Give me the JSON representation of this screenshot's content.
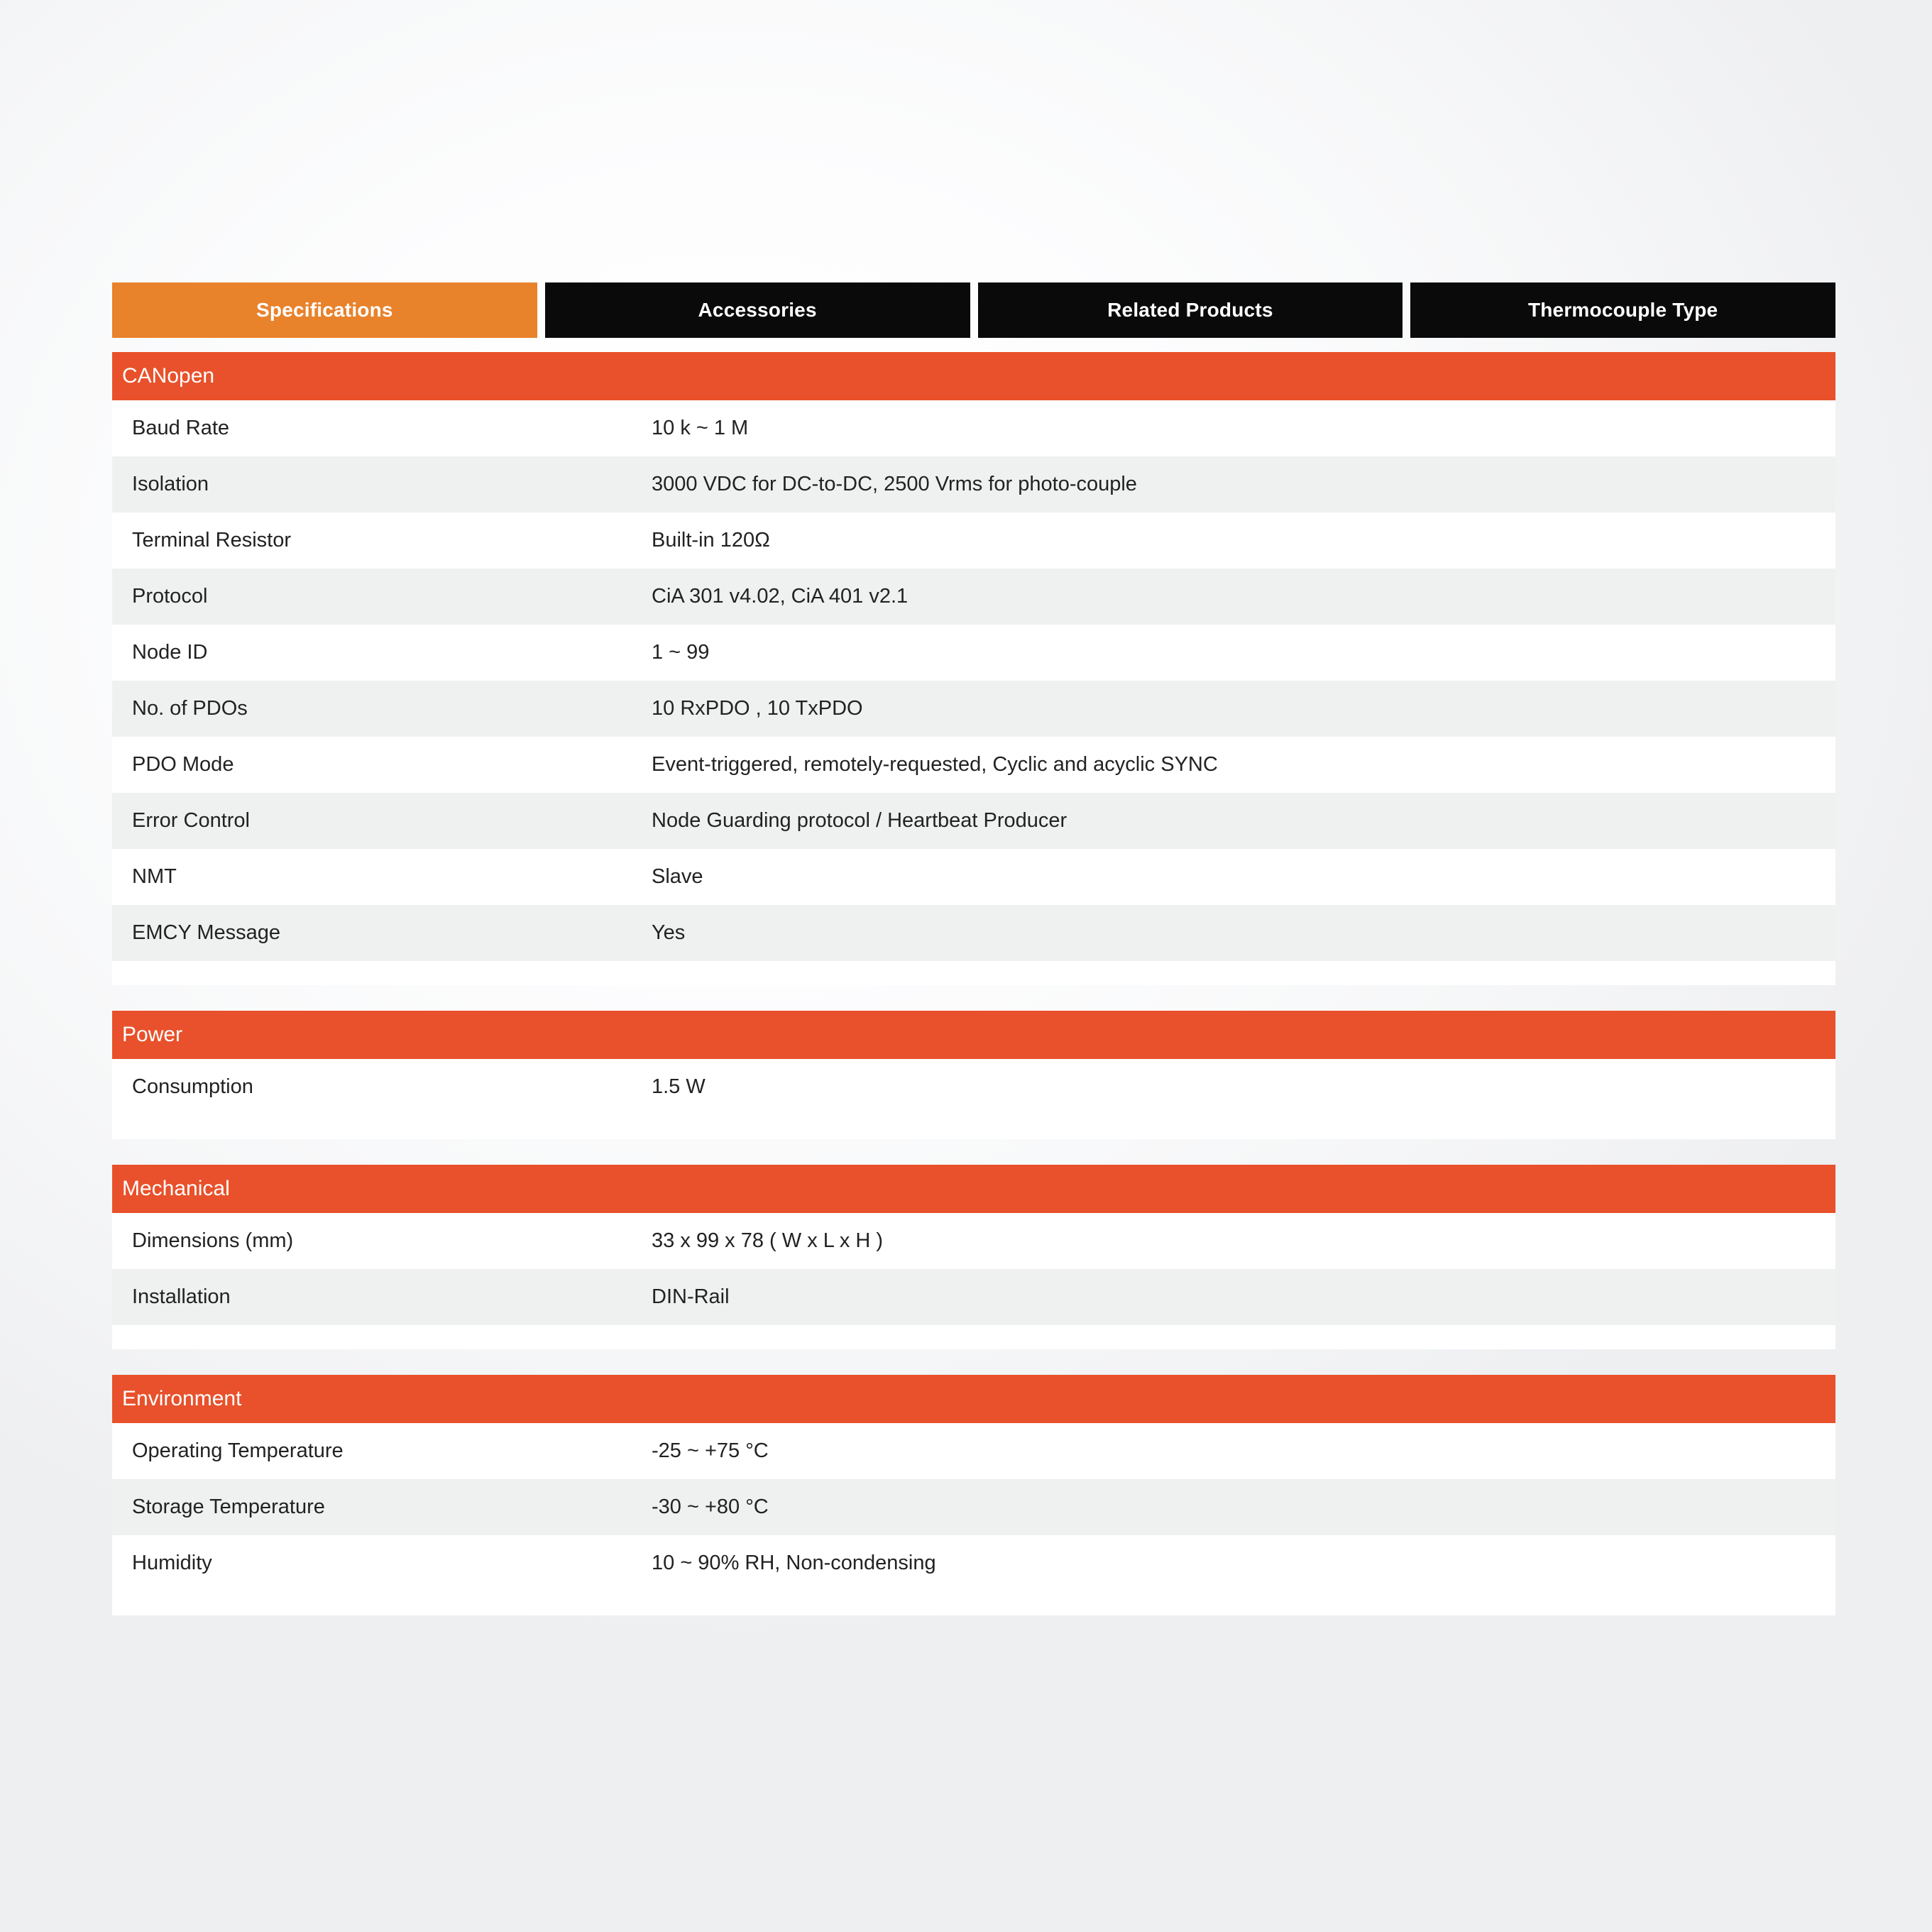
{
  "colors": {
    "active_tab": "#e8822b",
    "inactive_tab": "#0a0a0a",
    "section_header": "#e8512b",
    "row_alt": "#eff0f0",
    "text": "#222222"
  },
  "tabs": [
    {
      "label": "Specifications",
      "active": true
    },
    {
      "label": "Accessories",
      "active": false
    },
    {
      "label": "Related Products",
      "active": false
    },
    {
      "label": "Thermocouple Type",
      "active": false
    }
  ],
  "sections": [
    {
      "title": "CANopen",
      "rows": [
        {
          "label": "Baud Rate",
          "value": "10 k ~ 1 M"
        },
        {
          "label": "Isolation",
          "value": "3000 VDC for DC-to-DC, 2500 Vrms for photo-couple"
        },
        {
          "label": "Terminal Resistor",
          "value": "Built-in 120Ω"
        },
        {
          "label": "Protocol",
          "value": "CiA 301 v4.02, CiA 401 v2.1"
        },
        {
          "label": "Node ID",
          "value": "1 ~ 99"
        },
        {
          "label": "No. of PDOs",
          "value": "10 RxPDO , 10 TxPDO"
        },
        {
          "label": "PDO Mode",
          "value": "Event-triggered, remotely-requested, Cyclic and acyclic SYNC"
        },
        {
          "label": "Error Control",
          "value": "Node Guarding protocol / Heartbeat Producer"
        },
        {
          "label": "NMT",
          "value": "Slave"
        },
        {
          "label": "EMCY Message",
          "value": "Yes"
        }
      ]
    },
    {
      "title": "Power",
      "rows": [
        {
          "label": "Consumption",
          "value": "1.5 W"
        }
      ]
    },
    {
      "title": "Mechanical",
      "rows": [
        {
          "label": "Dimensions (mm)",
          "value": "33 x 99 x 78 ( W x L x H )"
        },
        {
          "label": "Installation",
          "value": "DIN-Rail"
        }
      ]
    },
    {
      "title": "Environment",
      "rows": [
        {
          "label": "Operating Temperature",
          "value": "-25 ~ +75 °C"
        },
        {
          "label": "Storage Temperature",
          "value": "-30 ~ +80 °C"
        },
        {
          "label": "Humidity",
          "value": "10 ~ 90% RH, Non-condensing"
        }
      ]
    }
  ]
}
